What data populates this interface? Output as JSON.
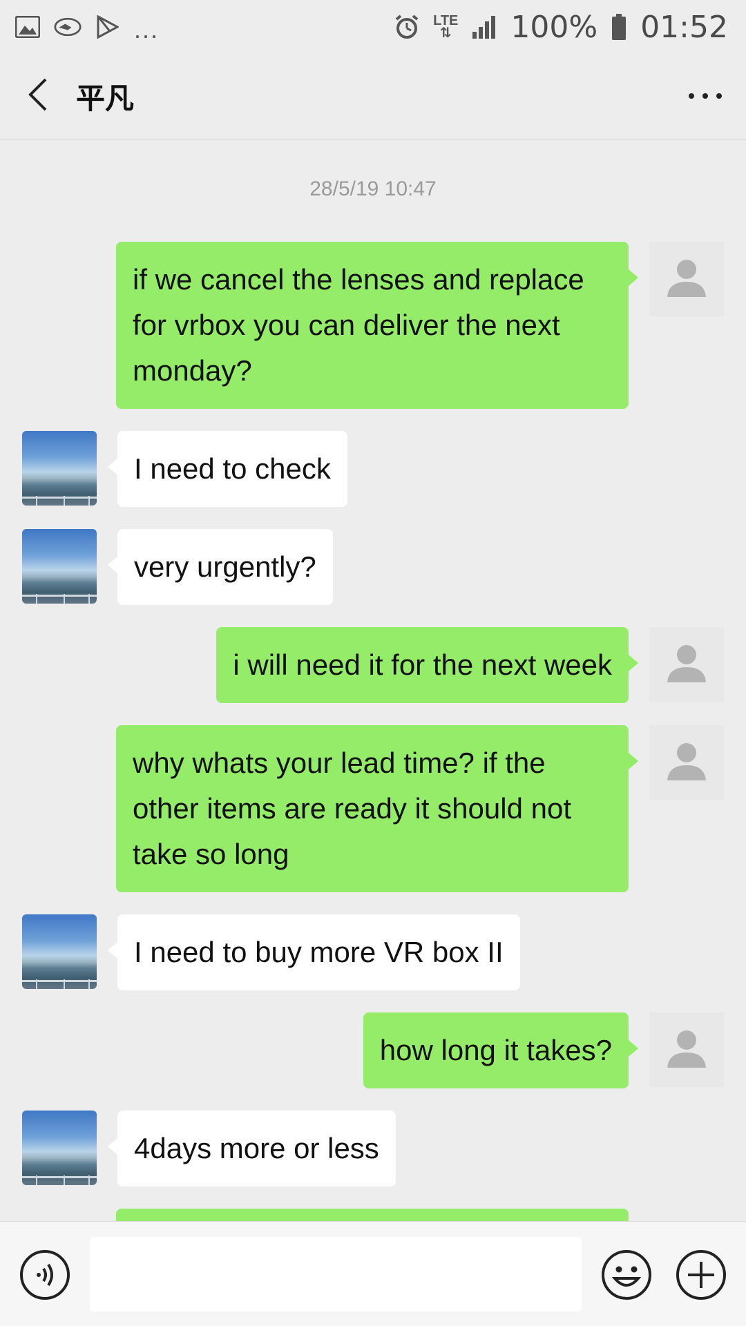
{
  "status_bar": {
    "icons_left": [
      "gallery-icon",
      "handshake-icon",
      "play-store-icon"
    ],
    "overflow": "...",
    "network": "LTE",
    "battery": "100%",
    "time": "01:52"
  },
  "header": {
    "title": "平凡",
    "back_icon": "chevron-left-icon",
    "more_icon": "more-horizontal-icon"
  },
  "chat": {
    "timestamp": "28/5/19 10:47",
    "messages": [
      {
        "from": "me",
        "text": "if we cancel the lenses and replace for vrbox you can deliver the next monday?"
      },
      {
        "from": "them",
        "text": "I need to check"
      },
      {
        "from": "them",
        "text": "very urgently?"
      },
      {
        "from": "me",
        "text": "i will need it for the next week"
      },
      {
        "from": "me",
        "text": "why whats your lead time? if the other items are ready it should not take so long"
      },
      {
        "from": "them",
        "text": "I need to buy more VR box II"
      },
      {
        "from": "me",
        "text": "how long it takes?"
      },
      {
        "from": "them",
        "text": "4days more or less"
      }
    ]
  },
  "colors": {
    "outgoing_bubble": "#95ec69",
    "incoming_bubble": "#ffffff",
    "background": "#ededed"
  },
  "input_bar": {
    "value": "",
    "icons": [
      "voice-icon",
      "emoji-icon",
      "plus-icon"
    ]
  }
}
